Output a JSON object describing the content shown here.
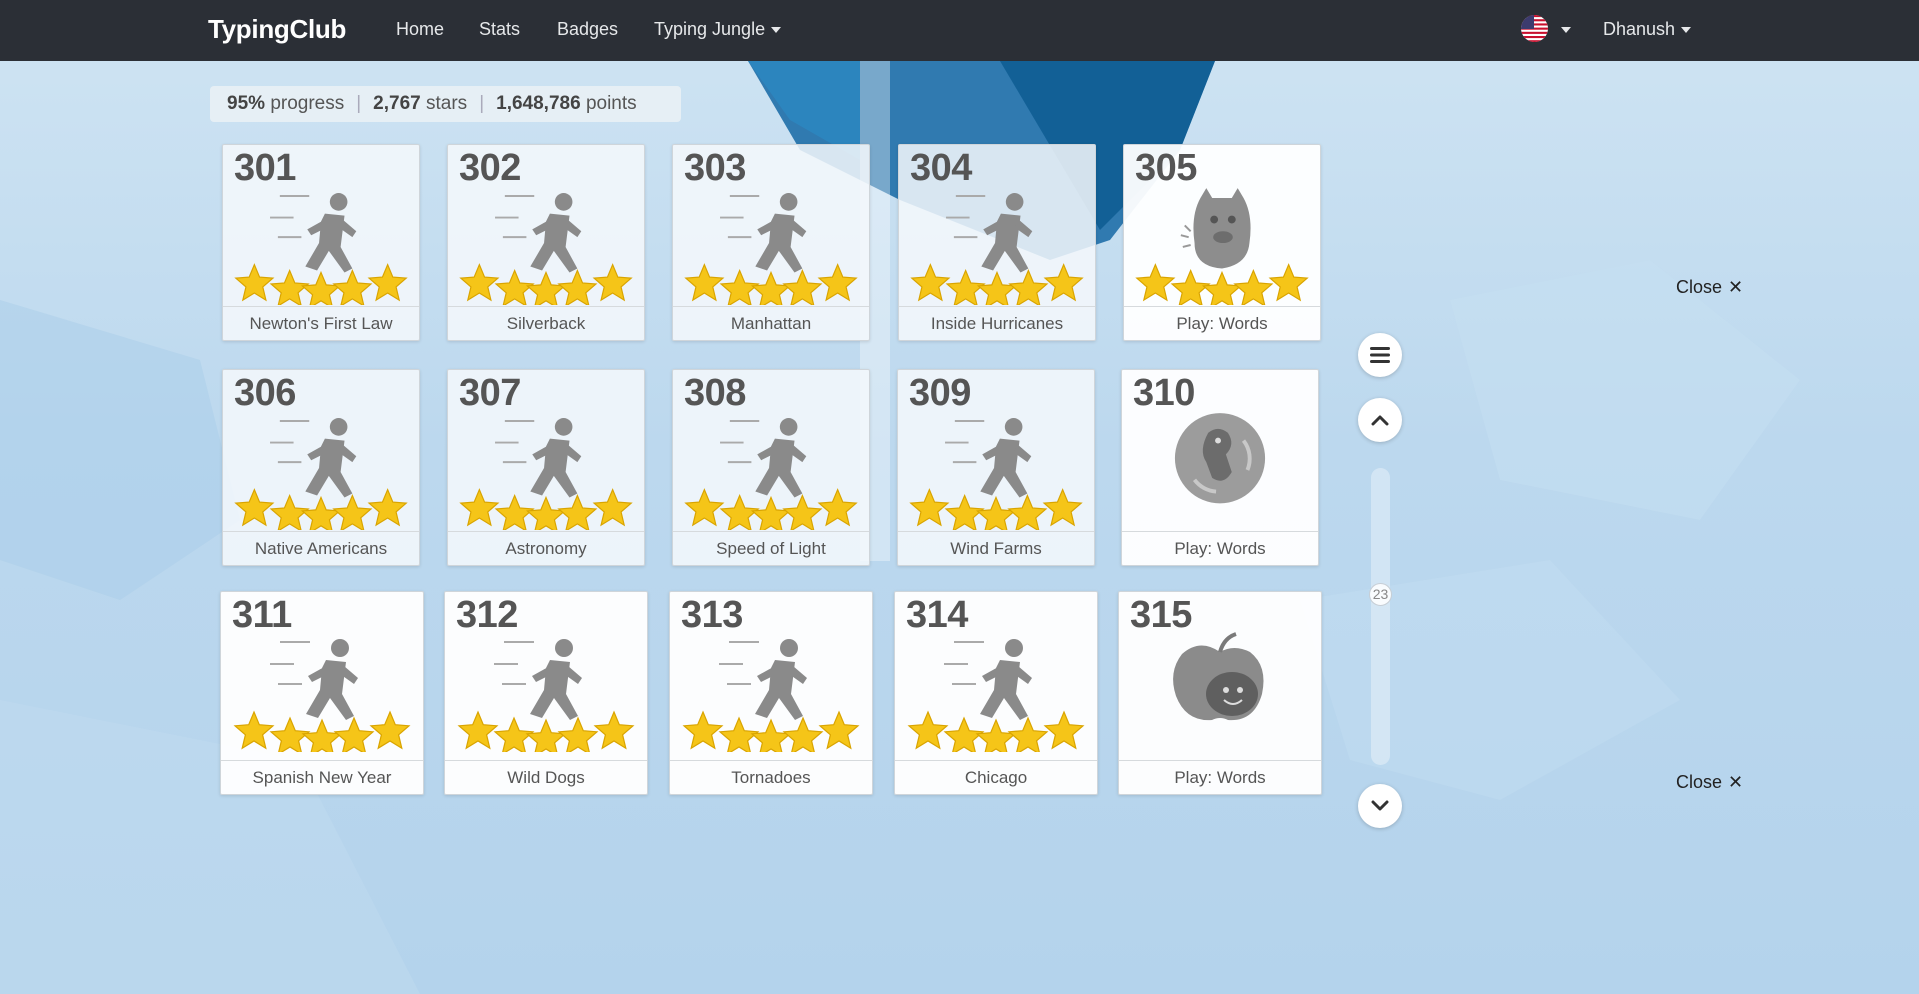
{
  "nav": {
    "brand": "TypingClub",
    "links": [
      "Home",
      "Stats",
      "Badges",
      "Typing Jungle"
    ],
    "user": "Dhanush",
    "flag_icon": "us-flag-icon"
  },
  "stats": {
    "progress_value": "95%",
    "progress_label": "progress",
    "stars_value": "2,767",
    "stars_label": "stars",
    "points_value": "1,648,786",
    "points_label": "points"
  },
  "lessons": [
    {
      "num": "301",
      "label": "Newton's First Law",
      "kind": "runner",
      "stars": 5
    },
    {
      "num": "302",
      "label": "Silverback",
      "kind": "runner",
      "stars": 5
    },
    {
      "num": "303",
      "label": "Manhattan",
      "kind": "runner",
      "stars": 5
    },
    {
      "num": "304",
      "label": "Inside Hurricanes",
      "kind": "runner",
      "stars": 5
    },
    {
      "num": "305",
      "label": "Play: Words",
      "kind": "monster",
      "stars": 5
    },
    {
      "num": "306",
      "label": "Native Americans",
      "kind": "runner",
      "stars": 5
    },
    {
      "num": "307",
      "label": "Astronomy",
      "kind": "runner",
      "stars": 5
    },
    {
      "num": "308",
      "label": "Speed of Light",
      "kind": "runner",
      "stars": 5
    },
    {
      "num": "309",
      "label": "Wind Farms",
      "kind": "runner",
      "stars": 5
    },
    {
      "num": "310",
      "label": "Play: Words",
      "kind": "bubble",
      "stars": 0
    },
    {
      "num": "311",
      "label": "Spanish New Year",
      "kind": "runner",
      "stars": 5
    },
    {
      "num": "312",
      "label": "Wild Dogs",
      "kind": "runner",
      "stars": 5
    },
    {
      "num": "313",
      "label": "Tornadoes",
      "kind": "runner",
      "stars": 5
    },
    {
      "num": "314",
      "label": "Chicago",
      "kind": "runner",
      "stars": 5
    },
    {
      "num": "315",
      "label": "Play: Words",
      "kind": "apple",
      "stars": 0
    }
  ],
  "side": {
    "menu_icon": "menu-icon",
    "up_icon": "chevron-up-icon",
    "down_icon": "chevron-down-icon",
    "page": "23"
  },
  "close_label": "Close",
  "colors": {
    "navbar": "#2b2f36",
    "star": "#f5c518",
    "tile_text": "#555555"
  }
}
